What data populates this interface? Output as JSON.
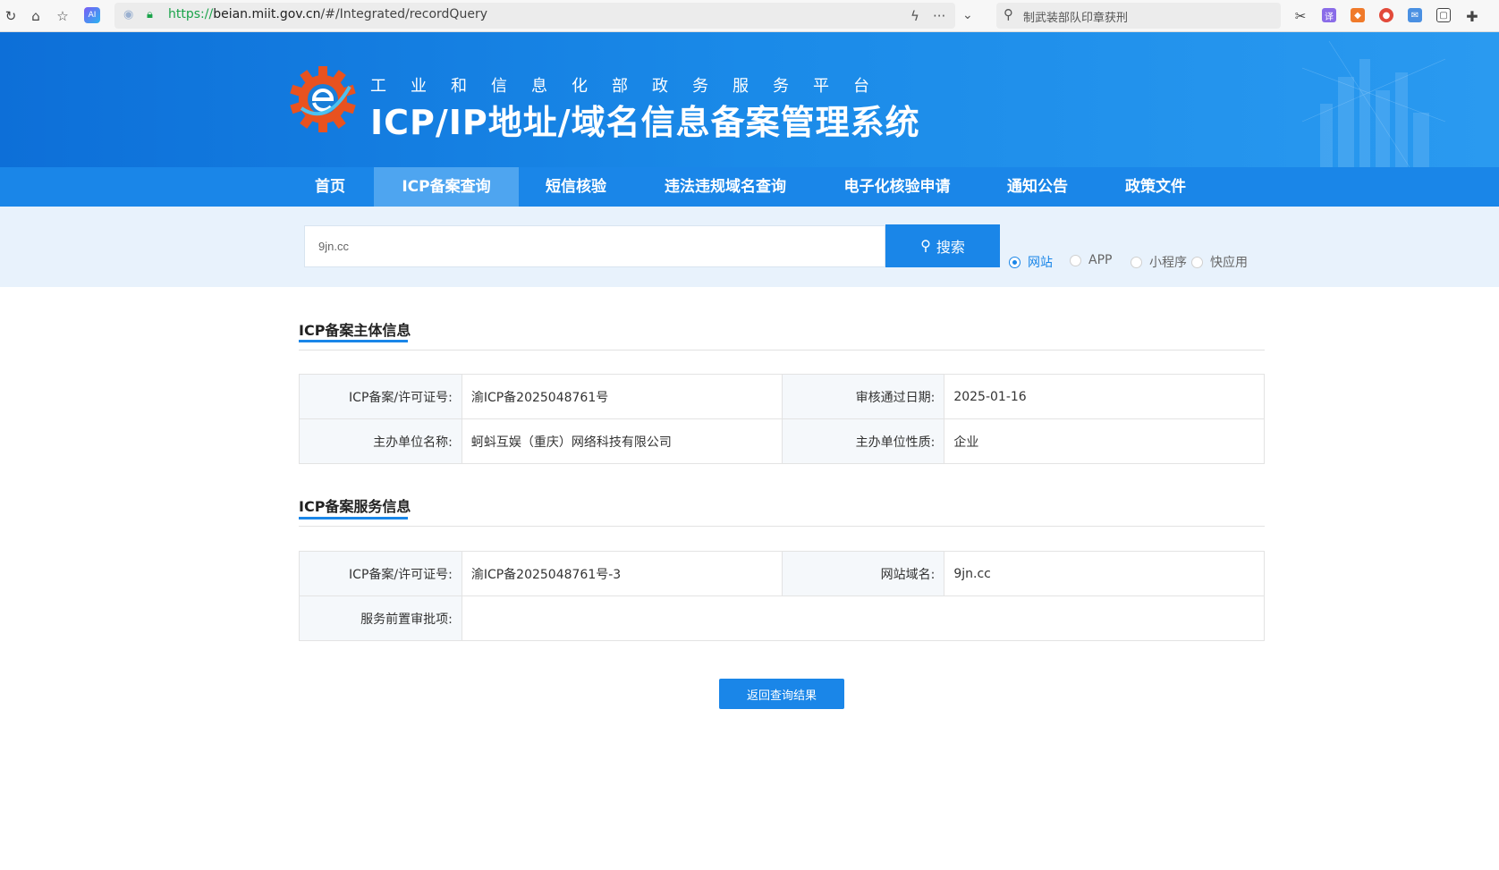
{
  "browser": {
    "url_scheme": "https://",
    "url_host": "beian.miit.gov.cn",
    "url_path": "/#/Integrated/recordQuery",
    "search_text": "制武装部队印章获刑"
  },
  "header": {
    "subtitle": "工业和信息化部政务服务平台",
    "title": "ICP/IP地址/域名信息备案管理系统"
  },
  "nav": {
    "items": [
      {
        "label": "首页"
      },
      {
        "label": "ICP备案查询"
      },
      {
        "label": "短信核验"
      },
      {
        "label": "违法违规域名查询"
      },
      {
        "label": "电子化核验申请"
      },
      {
        "label": "通知公告"
      },
      {
        "label": "政策文件"
      }
    ]
  },
  "search": {
    "value": "9jn.cc",
    "button_label": "搜索",
    "options": [
      {
        "label": "网站",
        "checked": true
      },
      {
        "label": "APP",
        "checked": false
      },
      {
        "label": "小程序",
        "checked": false
      },
      {
        "label": "快应用",
        "checked": false
      }
    ]
  },
  "subject_section": {
    "title": "ICP备案主体信息",
    "rows": [
      {
        "k1": "ICP备案/许可证号:",
        "v1": "渝ICP备2025048761号",
        "k2": "审核通过日期:",
        "v2": "2025-01-16"
      },
      {
        "k1": "主办单位名称:",
        "v1": "蚵蚪互娱（重庆）网络科技有限公司",
        "k2": "主办单位性质:",
        "v2": "企业"
      }
    ]
  },
  "service_section": {
    "title": "ICP备案服务信息",
    "row1": {
      "k1": "ICP备案/许可证号:",
      "v1": "渝ICP备2025048761号-3",
      "k2": "网站域名:",
      "v2": "9jn.cc"
    },
    "row2": {
      "k1": "服务前置审批项:",
      "v1": ""
    }
  },
  "back_button": "返回查询结果",
  "colors": {
    "primary": "#1a86e8",
    "nav_active": "#4ea5f0",
    "banner": "#0d6fd8",
    "band": "#e8f2fc"
  }
}
